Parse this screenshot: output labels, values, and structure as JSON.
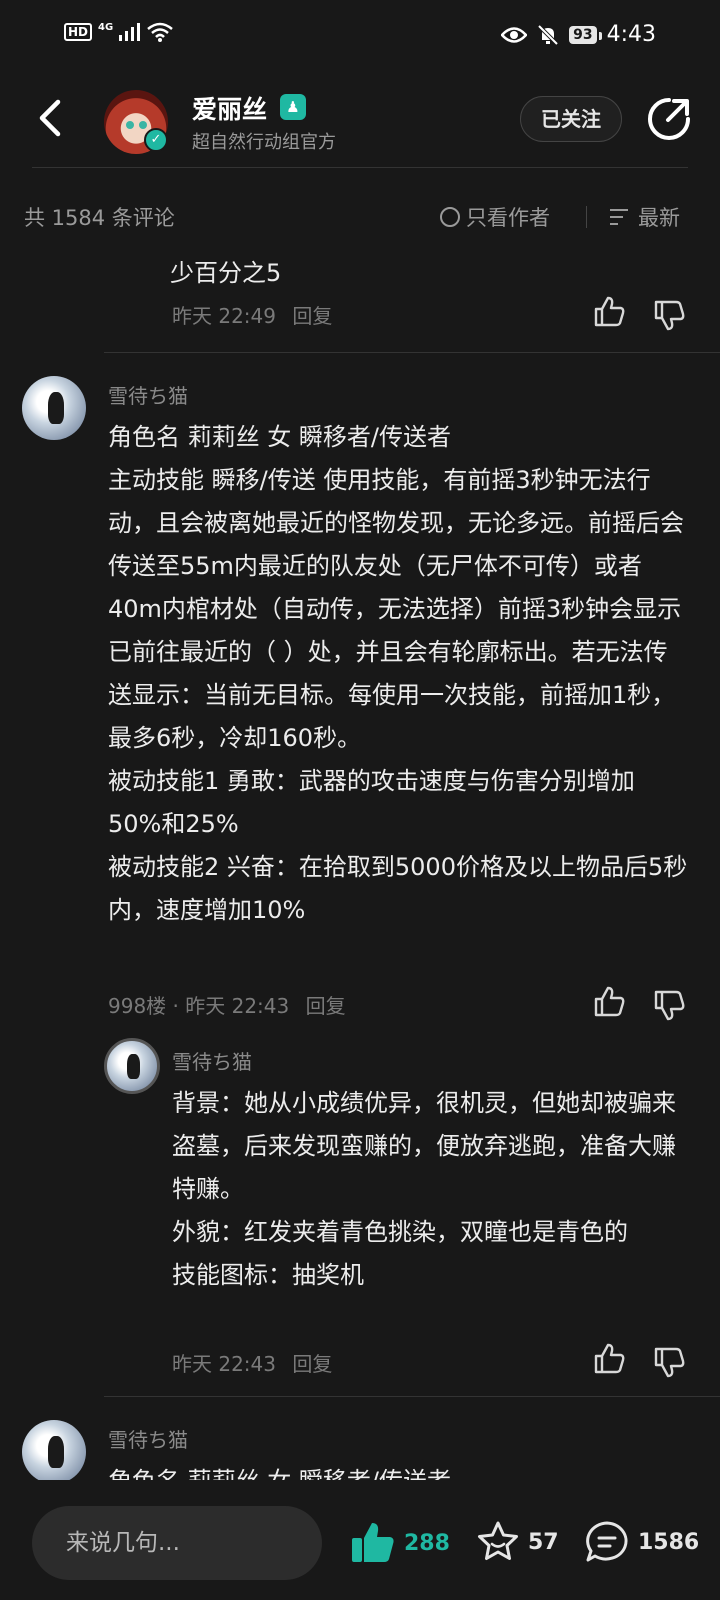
{
  "status_bar": {
    "hd": "HD",
    "network": "4G",
    "battery": "93",
    "time": "4:43"
  },
  "header": {
    "name": "爱丽丝",
    "subtitle": "超自然行动组官方",
    "follow_label": "已关注"
  },
  "filter": {
    "comment_count": "共 1584 条评论",
    "only_author": "只看作者",
    "sort": "最新"
  },
  "comments": [
    {
      "text": "少百分之5",
      "meta": "昨天 22:49",
      "reply_label": "回复"
    },
    {
      "username": "雪待ち猫",
      "text": "角色名 莉莉丝 女 瞬移者/传送者\n主动技能 瞬移/传送 使用技能，有前摇3秒钟无法行动，且会被离她最近的怪物发现，无论多远。前摇后会传送至55m内最近的队友处（无尸体不可传）或者40m内棺材处（自动传，无法选择）前摇3秒钟会显示 已前往最近的（ ）处，并且会有轮廓标出。若无法传送显示：当前无目标。每使用一次技能，前摇加1秒，最多6秒，冷却160秒。\n被动技能1 勇敢：武器的攻击速度与伤害分别增加50%和25%\n被动技能2 兴奋：在拾取到5000价格及以上物品后5秒内，速度增加10%",
      "meta": "998楼 · 昨天 22:43",
      "reply_label": "回复"
    },
    {
      "username": "雪待ち猫",
      "text": "背景：她从小成绩优异，很机灵，但她却被骗来盗墓，后来发现蛮赚的，便放弃逃跑，准备大赚特赚。\n外貌：红发夹着青色挑染，双瞳也是青色的\n技能图标：抽奖机",
      "meta": "昨天 22:43",
      "reply_label": "回复"
    },
    {
      "username": "雪待ち猫",
      "text": "角色名 莉莉丝 女 瞬移者/传送者"
    }
  ],
  "bottom_bar": {
    "input_placeholder": "来说几句...",
    "like_count": "288",
    "favorite_count": "57",
    "comment_count": "1586"
  },
  "colors": {
    "accent": "#1fb8a2",
    "background": "#181818",
    "divider": "#333333"
  }
}
